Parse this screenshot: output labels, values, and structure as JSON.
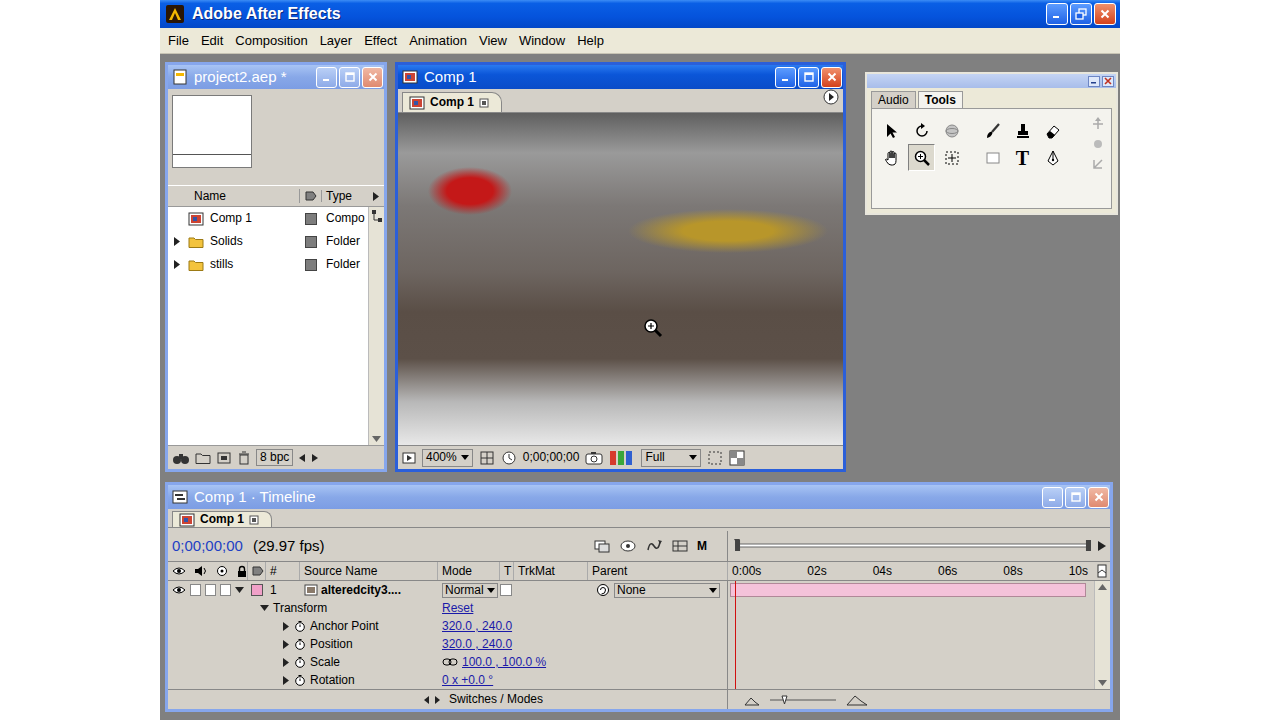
{
  "app": {
    "title": "Adobe After Effects",
    "menu": [
      "File",
      "Edit",
      "Composition",
      "Layer",
      "Effect",
      "Animation",
      "View",
      "Window",
      "Help"
    ]
  },
  "project": {
    "title": "project2.aep *",
    "active": false,
    "columns": [
      "Name",
      "Type"
    ],
    "items": [
      {
        "name": "Comp 1",
        "type": "Compo",
        "kind": "comp",
        "expanded": false
      },
      {
        "name": "Solids",
        "type": "Folder",
        "kind": "folder",
        "expanded": false
      },
      {
        "name": "stills",
        "type": "Folder",
        "kind": "folder",
        "expanded": false
      }
    ],
    "depth": "8 bpc"
  },
  "comp": {
    "title": "Comp 1",
    "active": true,
    "tab": "Comp 1",
    "zoom": "400%",
    "time": "0;00;00;00",
    "resolution": "Full"
  },
  "palette": {
    "tabs": [
      {
        "label": "Audio",
        "selected": false
      },
      {
        "label": "Tools",
        "selected": true
      }
    ],
    "tools": [
      {
        "kind": "selection",
        "selected": false
      },
      {
        "kind": "rotate",
        "selected": false
      },
      {
        "kind": "orbit",
        "selected": false
      },
      {
        "kind": "brush",
        "selected": false
      },
      {
        "kind": "clone",
        "selected": false
      },
      {
        "kind": "eraser",
        "selected": false
      },
      {
        "kind": "hand",
        "selected": false
      },
      {
        "kind": "zoom",
        "selected": true
      },
      {
        "kind": "panbehind",
        "selected": false
      },
      {
        "kind": "rectangle",
        "selected": false
      },
      {
        "kind": "type",
        "label": "T",
        "selected": false
      },
      {
        "kind": "pen",
        "selected": false
      }
    ]
  },
  "timeline": {
    "title": "Comp 1 · Timeline",
    "active": false,
    "tab": "Comp 1",
    "time": "0;00;00;00",
    "fps": "(29.97 fps)",
    "motion_blur_label": "M",
    "columns": [
      "#",
      "Source Name",
      "Mode",
      "T",
      "TrkMat",
      "Parent"
    ],
    "ticks": [
      "0:00s",
      "02s",
      "04s",
      "06s",
      "08s",
      "10s"
    ],
    "layers": [
      {
        "number": "1",
        "name": "alteredcity3....",
        "mode": "Normal",
        "parent": "None",
        "expanded": true,
        "visible": true
      }
    ],
    "transform": {
      "label": "Transform",
      "reset": "Reset",
      "expanded": true,
      "properties": [
        {
          "name": "Anchor Point",
          "value": "320.0 , 240.0"
        },
        {
          "name": "Position",
          "value": "320.0 , 240.0"
        },
        {
          "name": "Scale",
          "value": "100.0 , 100.0 %"
        },
        {
          "name": "Rotation",
          "value": "0 x +0.0 °"
        }
      ]
    },
    "footer": "Switches / Modes"
  }
}
